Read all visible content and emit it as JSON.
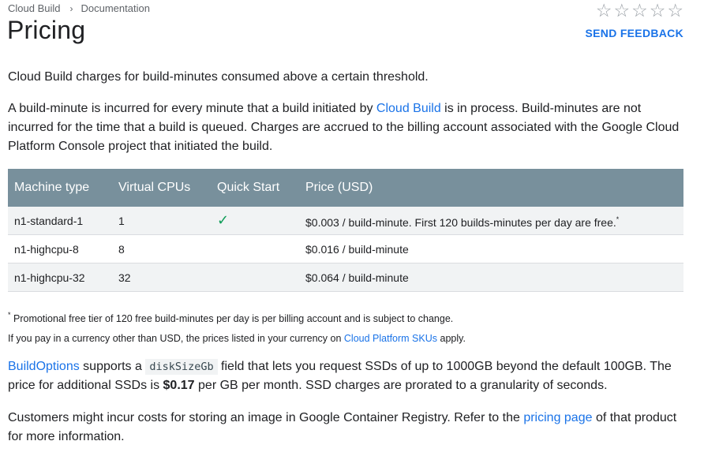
{
  "breadcrumb": {
    "item1": "Cloud Build",
    "separator": "›",
    "item2": "Documentation"
  },
  "page_title": "Pricing",
  "rating": {
    "stars": [
      "☆",
      "☆",
      "☆",
      "☆",
      "☆"
    ]
  },
  "feedback_label": "SEND FEEDBACK",
  "intro": "Cloud Build charges for build-minutes consumed above a certain threshold.",
  "para2": {
    "before": "A build-minute is incurred for every minute that a build initiated by ",
    "link": "Cloud Build",
    "after": " is in process. Build-minutes are not incurred for the time that a build is queued. Charges are accrued to the billing account associated with the Google Cloud Platform Console project that initiated the build."
  },
  "table": {
    "headers": [
      "Machine type",
      "Virtual CPUs",
      "Quick Start",
      "Price (USD)"
    ],
    "rows": [
      {
        "machine": "n1-standard-1",
        "cpus": "1",
        "quick_start": "✓",
        "price": "$0.003 / build-minute. First 120 builds-minutes per day are free.",
        "price_sup": "*"
      },
      {
        "machine": "n1-highcpu-8",
        "cpus": "8",
        "quick_start": "",
        "price": "$0.016 / build-minute",
        "price_sup": ""
      },
      {
        "machine": "n1-highcpu-32",
        "cpus": "32",
        "quick_start": "",
        "price": "$0.064 / build-minute",
        "price_sup": ""
      }
    ]
  },
  "notes": {
    "note1_sup": "*",
    "note1": " Promotional free tier of 120 free build-minutes per day is per billing account and is subject to change.",
    "note2_before": "If you pay in a currency other than USD, the prices listed in your currency on ",
    "note2_link": "Cloud Platform SKUs",
    "note2_after": " apply."
  },
  "para3": {
    "link": "BuildOptions",
    "text1": " supports a ",
    "code": "diskSizeGb",
    "text2": " field that lets you request SSDs of up to 1000GB beyond the default 100GB. The price for additional SSDs is ",
    "price": "$0.17",
    "text3": " per GB per month. SSD charges are prorated to a granularity of seconds."
  },
  "para4": {
    "before": "Customers might incur costs for storing an image in Google Container Registry. Refer to the ",
    "link": "pricing page",
    "after": " of that product for more information."
  }
}
